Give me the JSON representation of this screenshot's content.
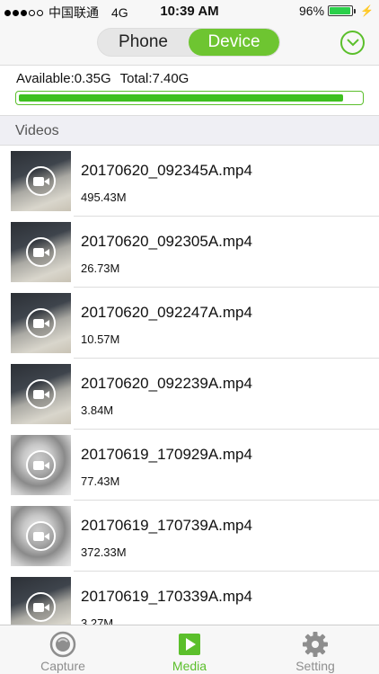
{
  "status_bar": {
    "carrier": "中国联通",
    "network": "4G",
    "time": "10:39 AM",
    "battery": "96%",
    "battery_level": 0.96
  },
  "header": {
    "tabs": [
      {
        "label": "Phone",
        "active": false
      },
      {
        "label": "Device",
        "active": true
      }
    ],
    "dropdown_icon": "chevron-down-circle-icon",
    "accent_color": "#6ec531"
  },
  "storage": {
    "available": "Available:0.35G",
    "total": "Total:7.40G",
    "used_fraction": 0.95
  },
  "section": {
    "title": "Videos"
  },
  "videos": [
    {
      "name": "20170620_092345A.mp4",
      "size": "495.43M",
      "thumb": "dark"
    },
    {
      "name": "20170620_092305A.mp4",
      "size": "26.73M",
      "thumb": "dark"
    },
    {
      "name": "20170620_092247A.mp4",
      "size": "10.57M",
      "thumb": "dark"
    },
    {
      "name": "20170620_092239A.mp4",
      "size": "3.84M",
      "thumb": "dark"
    },
    {
      "name": "20170619_170929A.mp4",
      "size": "77.43M",
      "thumb": "gray"
    },
    {
      "name": "20170619_170739A.mp4",
      "size": "372.33M",
      "thumb": "gray"
    },
    {
      "name": "20170619_170339A.mp4",
      "size": "3.27M",
      "thumb": "dark"
    }
  ],
  "tab_bar": {
    "items": [
      {
        "label": "Capture",
        "icon": "camera-lens-icon",
        "active": false
      },
      {
        "label": "Media",
        "icon": "play-icon",
        "active": true
      },
      {
        "label": "Setting",
        "icon": "gear-icon",
        "active": false
      }
    ]
  }
}
